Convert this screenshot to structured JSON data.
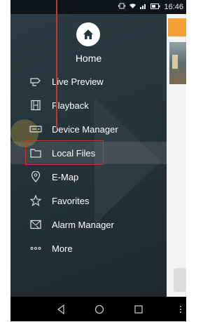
{
  "status_bar": {
    "time": "16:46"
  },
  "drawer": {
    "home_label": "Home",
    "items": [
      {
        "label": "Live Preview",
        "icon": "camera-icon"
      },
      {
        "label": "Playback",
        "icon": "film-icon"
      },
      {
        "label": "Device Manager",
        "icon": "dvr-icon"
      },
      {
        "label": "Local Files",
        "icon": "folder-icon",
        "active": true
      },
      {
        "label": "E-Map",
        "icon": "map-pin-icon"
      },
      {
        "label": "Favorites",
        "icon": "star-icon"
      },
      {
        "label": "Alarm Manager",
        "icon": "alarm-icon"
      },
      {
        "label": "More",
        "icon": "more-icon"
      }
    ]
  },
  "colors": {
    "drawer_bg": "#26343b",
    "highlight": "#c0392b",
    "accent_tile": "#f5a033"
  }
}
